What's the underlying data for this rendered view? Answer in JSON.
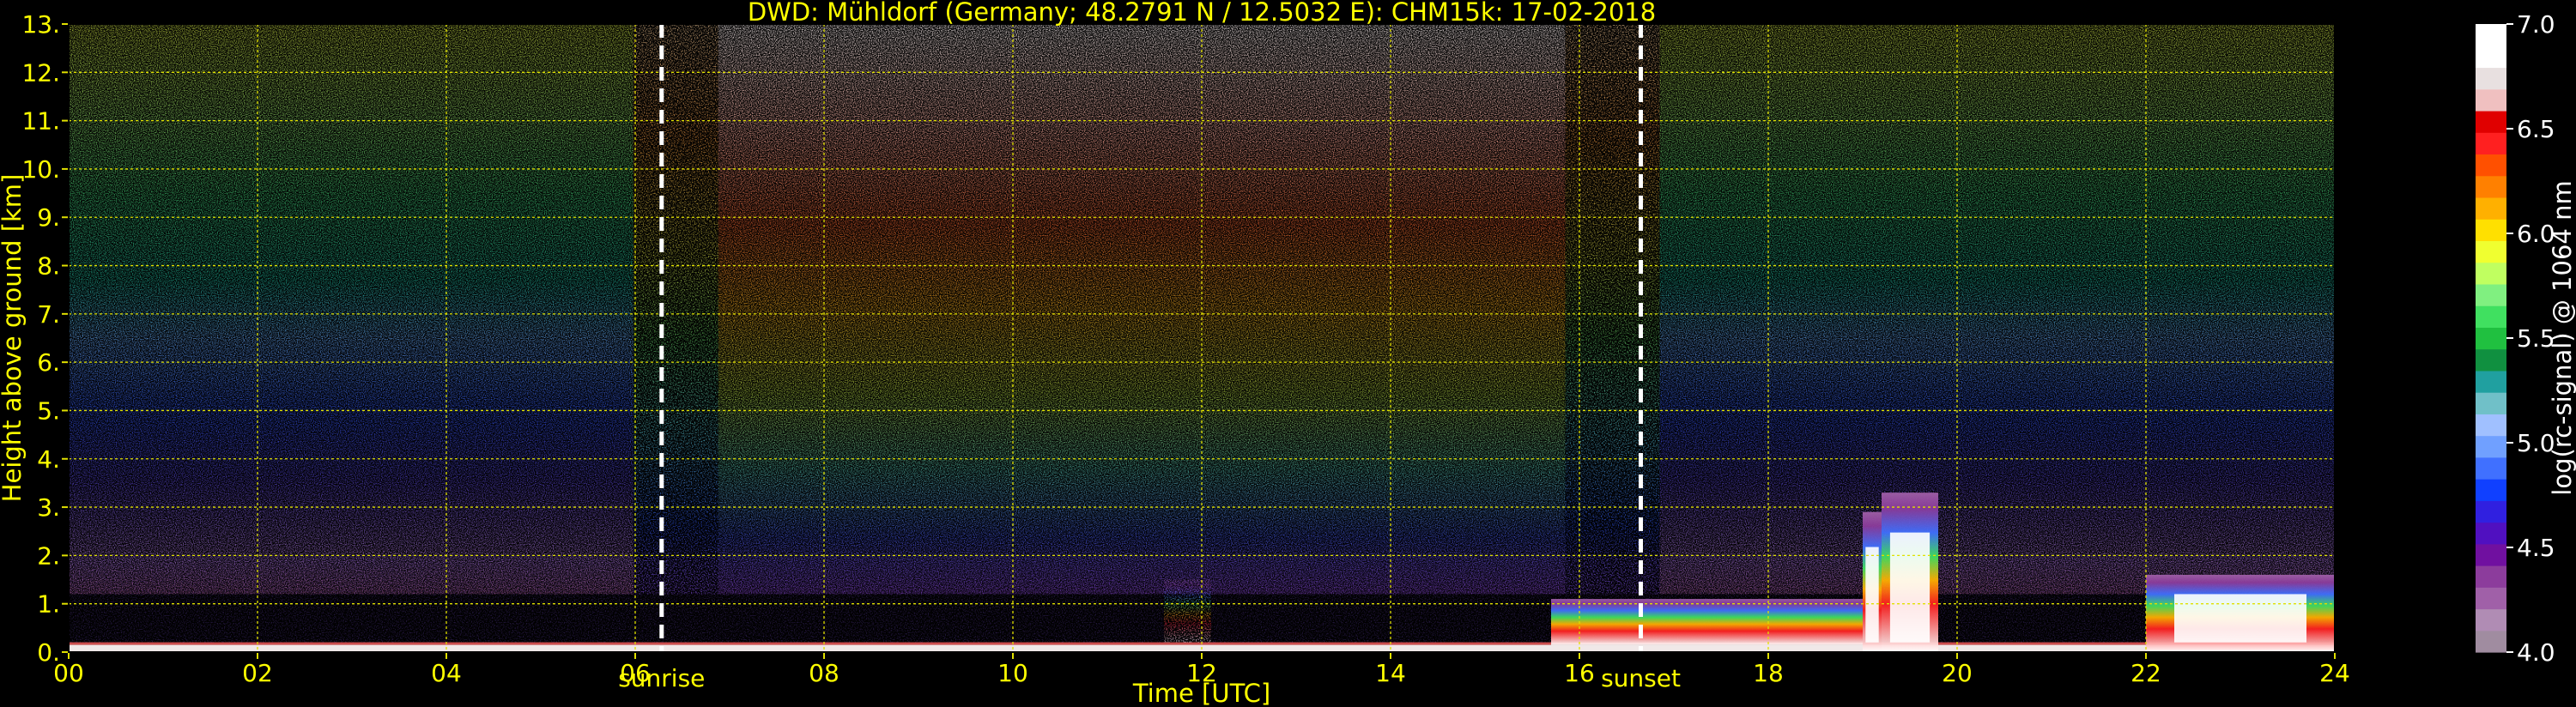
{
  "chart_data": {
    "type": "heatmap",
    "title": "DWD: Mühldorf (Germany; 48.2791 N / 12.5032 E):    CHM15k: 17-02-2018",
    "xlabel": "Time [UTC]",
    "ylabel": "Height above ground [km]",
    "xlim": [
      0,
      24
    ],
    "ylim": [
      0,
      13
    ],
    "x_ticks": [
      0,
      2,
      4,
      6,
      8,
      10,
      12,
      14,
      16,
      18,
      20,
      22,
      24
    ],
    "x_tick_labels": [
      "00",
      "02",
      "04",
      "06",
      "08",
      "10",
      "12",
      "14",
      "16",
      "18",
      "20",
      "22",
      "24"
    ],
    "y_ticks": [
      0,
      1,
      2,
      3,
      4,
      5,
      6,
      7,
      8,
      9,
      10,
      11,
      12,
      13
    ],
    "y_tick_labels": [
      "0.",
      "1.",
      "2.",
      "3.",
      "4.",
      "5.",
      "6.",
      "7.",
      "8.",
      "9.",
      "10.",
      "11.",
      "12.",
      "13."
    ],
    "grid": true,
    "markers": [
      {
        "label": "sunrise",
        "x": 6.28
      },
      {
        "label": "sunset",
        "x": 16.65
      }
    ],
    "colorbar": {
      "label": "log(rc-signal) @ 1064 nm",
      "range": [
        4.0,
        7.0
      ],
      "ticks": [
        4.0,
        4.5,
        5.0,
        5.5,
        6.0,
        6.5,
        7.0
      ],
      "tick_labels": [
        "4.0",
        "4.5",
        "5.0",
        "5.5",
        "6.0",
        "6.5",
        "7.0"
      ],
      "colors": [
        "#a08ca0",
        "#b08cb4",
        "#a060a8",
        "#8c3c9c",
        "#7010a0",
        "#5010c0",
        "#3020e0",
        "#1040ff",
        "#4070ff",
        "#70a0ff",
        "#a0c0ff",
        "#70c0c8",
        "#20a0a0",
        "#109040",
        "#20c040",
        "#40e060",
        "#80f080",
        "#c0ff60",
        "#f0ff30",
        "#ffe000",
        "#ffb000",
        "#ff8000",
        "#ff5000",
        "#ff2020",
        "#e00000",
        "#f0c0c0",
        "#e8e0e0",
        "#ffffff",
        "#ffffff"
      ]
    },
    "features": [
      {
        "kind": "boundary-layer",
        "x": [
          0,
          24
        ],
        "top_km": 0.15
      },
      {
        "kind": "aerosol-layer",
        "x": [
          15.7,
          19.0
        ],
        "top_km": 1.1
      },
      {
        "kind": "cloud",
        "x": [
          19.2,
          19.8
        ],
        "top_km": 3.3
      },
      {
        "kind": "cloud",
        "x": [
          19.0,
          19.2
        ],
        "top_km": 2.9
      },
      {
        "kind": "aerosol",
        "x": [
          11.6,
          12.1
        ],
        "top_km": 1.5
      },
      {
        "kind": "cloud",
        "x": [
          22.0,
          24
        ],
        "top_km": 1.6
      }
    ]
  }
}
